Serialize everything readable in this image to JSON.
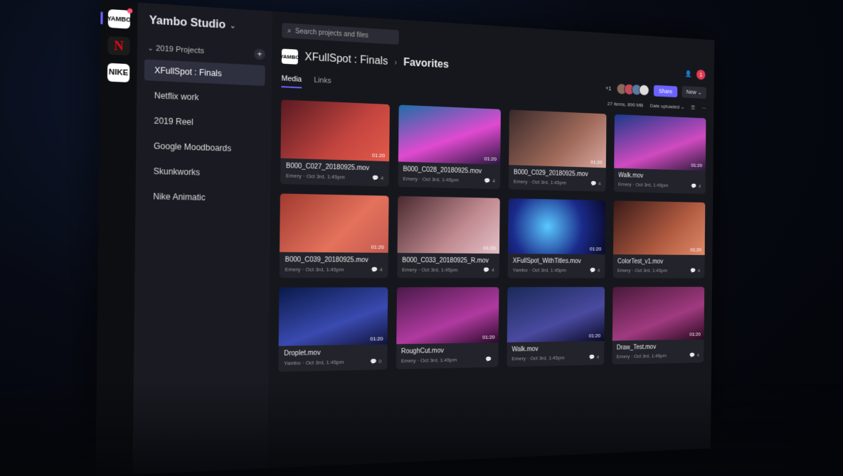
{
  "workspace_rail": [
    {
      "label": "YAMBO",
      "icon": "yambo-logo-icon"
    },
    {
      "label": "N",
      "icon": "netflix-logo-icon"
    },
    {
      "label": "NIKE",
      "icon": "nike-logo-icon"
    }
  ],
  "sidebar": {
    "studio_name": "Yambo Studio",
    "group_label": "2019 Projects",
    "add_label": "+",
    "items": [
      {
        "label": "XFullSpot : Finals"
      },
      {
        "label": "Netflix work"
      },
      {
        "label": "2019 Reel"
      },
      {
        "label": "Google Moodboards"
      },
      {
        "label": "Skunkworks"
      },
      {
        "label": "Nike Animatic"
      }
    ]
  },
  "search": {
    "placeholder": "Search projects and files"
  },
  "header": {
    "logo": "YAMBO",
    "project": "XFullSpot : Finals",
    "section": "Favorites"
  },
  "tabs": [
    {
      "label": "Media"
    },
    {
      "label": "Links"
    }
  ],
  "toolbar": {
    "notification_count": "1",
    "extra_collaborators": "+1",
    "share_label": "Share",
    "new_label": "New",
    "summary": "27 items, 890 MB",
    "sort_label": "Date uploaded"
  },
  "colors": {
    "accent": "#6b63ff",
    "notif": "#e23a53"
  },
  "media": [
    {
      "name": "B000_C027_20180925.mov",
      "author": "Emery",
      "date": "Oct 3rd, 1:45pm",
      "duration": "01:20",
      "comments": "4",
      "bg": "linear-gradient(135deg,#5a1a22,#c4453f 60%,#e25a4a)"
    },
    {
      "name": "B000_C028_20180925.mov",
      "author": "Emery",
      "date": "Oct 3rd, 1:45pm",
      "duration": "01:20",
      "comments": "4",
      "bg": "linear-gradient(160deg,#1d6ea8,#e04ad0 55%,#2a1740)"
    },
    {
      "name": "B000_C029_20180925.mov",
      "author": "Emery",
      "date": "Oct 3rd, 1:45pm",
      "duration": "01:20",
      "comments": "4",
      "bg": "linear-gradient(135deg,#3a2a2a,#a06a5a 60%,#d9a8a0)"
    },
    {
      "name": "Walk.mov",
      "author": "Emery",
      "date": "Oct 3rd, 1:45pm",
      "duration": "01:20",
      "comments": "4",
      "bg": "linear-gradient(160deg,#1a3a8a,#d04ac0 60%,#2a1a3a)"
    },
    {
      "name": "B000_C039_20180925.mov",
      "author": "Emery",
      "date": "Oct 3rd, 1:45pm",
      "duration": "01:20",
      "comments": "4",
      "bg": "linear-gradient(135deg,#a03a30,#e4725c 60%,#c45a50)"
    },
    {
      "name": "B000_C033_20180925_R.mov",
      "author": "Emery",
      "date": "Oct 3rd, 1:45pm",
      "duration": "01:20",
      "comments": "4",
      "bg": "linear-gradient(135deg,#4a2a30,#c08a90 60%,#e4c0c8)"
    },
    {
      "name": "XFullSpot_WithTitles.mov",
      "author": "Yambo",
      "date": "Oct 3rd, 1:45pm",
      "duration": "01:20",
      "comments": "4",
      "bg": "radial-gradient(circle at 40% 50%,#5ac8ff,#1a2a8a 55%,#0a0a2a)"
    },
    {
      "name": "ColorTest_v1.mov",
      "author": "Emery",
      "date": "Oct 3rd, 1:45pm",
      "duration": "01:20",
      "comments": "4",
      "bg": "linear-gradient(135deg,#3a1a18,#b05a40 60%,#e08a6a)"
    },
    {
      "name": "Droplet.mov",
      "author": "Yambo",
      "date": "Oct 3rd, 1:45pm",
      "duration": "01:20",
      "comments": "0",
      "bg": "linear-gradient(160deg,#0a1a4a,#3a4ab0 60%,#10143a)"
    },
    {
      "name": "RoughCut.mov",
      "author": "Emery",
      "date": "Oct 3rd, 1:45pm",
      "duration": "01:20",
      "comments": "",
      "bg": "linear-gradient(160deg,#4a1a4a,#b03aa0 60%,#2a0a2a)"
    },
    {
      "name": "Walk.mov",
      "author": "Emery",
      "date": "Oct 3rd, 1:45pm",
      "duration": "01:20",
      "comments": "4",
      "bg": "linear-gradient(160deg,#1a2a5a,#4a4aa0 60%,#0a0a2a)"
    },
    {
      "name": "Draw_Test.mov",
      "author": "Emery",
      "date": "Oct 3rd, 1:45pm",
      "duration": "01:20",
      "comments": "4",
      "bg": "linear-gradient(160deg,#4a1a3a,#a03a80 60%,#2a0a20)"
    }
  ]
}
